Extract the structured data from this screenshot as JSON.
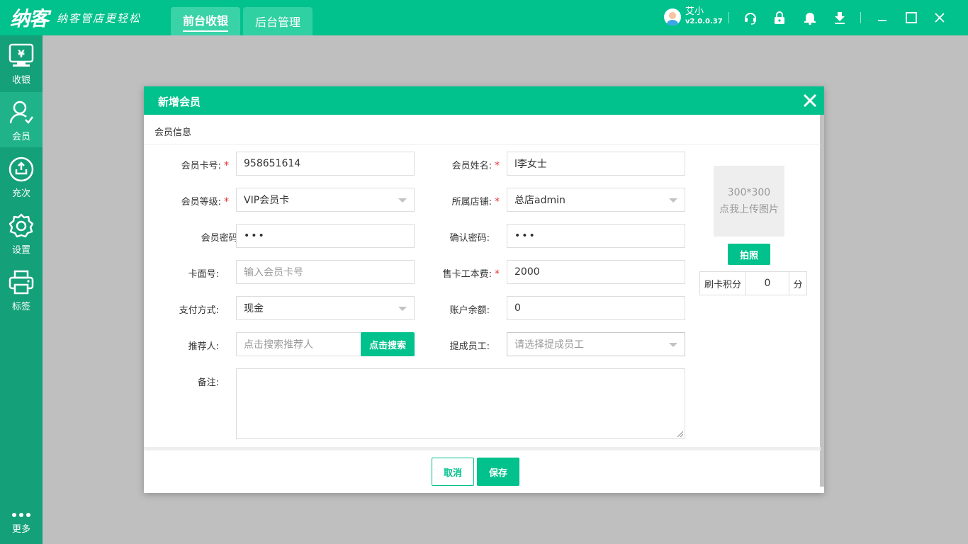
{
  "app": {
    "logo": "纳客",
    "slogan": "纳客管店更轻松",
    "tabs": [
      {
        "label": "前台收银",
        "active": true
      },
      {
        "label": "后台管理",
        "active": false
      }
    ],
    "user": {
      "name": "艾小",
      "version": "v2.0.0.37"
    },
    "icons": [
      "headset-icon",
      "lock-icon",
      "bell-icon",
      "download-icon",
      "minimize-icon",
      "maximize-icon",
      "close-icon"
    ],
    "accent": "#01c18c"
  },
  "sidebar": {
    "items": [
      {
        "label": "收银",
        "icon": "cash-register-icon"
      },
      {
        "label": "会员",
        "icon": "member-icon",
        "active": true
      },
      {
        "label": "充次",
        "icon": "recharge-icon"
      },
      {
        "label": "设置",
        "icon": "gear-icon"
      },
      {
        "label": "标签",
        "icon": "printer-icon"
      }
    ],
    "more_label": "更多"
  },
  "dialog": {
    "title": "新增会员",
    "section": "会员信息",
    "fields": {
      "card_no": {
        "label": "会员卡号:",
        "value": "958651614",
        "required": true
      },
      "name": {
        "label": "会员姓名:",
        "value": "l李女士",
        "required": true
      },
      "level": {
        "label": "会员等级:",
        "value": "VIP会员卡",
        "required": true
      },
      "store": {
        "label": "所属店铺:",
        "value": "总店admin",
        "required": true
      },
      "password": {
        "label": "会员密码:",
        "value": "•••"
      },
      "confirm_password": {
        "label": "确认密码:",
        "value": "•••"
      },
      "face_no": {
        "label": "卡面号:",
        "placeholder": "输入会员卡号"
      },
      "card_fee": {
        "label": "售卡工本费:",
        "value": "2000",
        "required": true
      },
      "payment": {
        "label": "支付方式:",
        "value": "现金"
      },
      "balance": {
        "label": "账户余额:",
        "value": "0"
      },
      "referrer": {
        "label": "推荐人:",
        "placeholder": "点击搜索推荐人",
        "button": "点击搜索"
      },
      "staff": {
        "label": "提成员工:",
        "placeholder": "请选择提成员工"
      },
      "remark": {
        "label": "备注:"
      }
    },
    "upload": {
      "size": "300*300",
      "hint": "点我上传图片",
      "photo_button": "拍照"
    },
    "points": {
      "label": "刷卡积分",
      "value": "0",
      "unit": "分"
    },
    "buttons": {
      "cancel": "取消",
      "save": "保存"
    }
  }
}
